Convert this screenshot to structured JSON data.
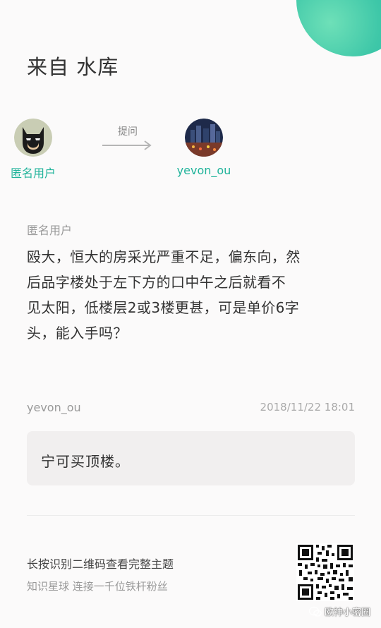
{
  "header": {
    "title": "来自 水库"
  },
  "participants": {
    "asker": {
      "name": "匿名用户",
      "avatar": "batman-mask-icon"
    },
    "action_label": "提问",
    "answerer": {
      "name": "yevon_ou",
      "avatar": "night-city-photo"
    }
  },
  "question": {
    "author": "匿名用户",
    "lines": [
      "殴大，恒大的房采光严重不足，偏东向，然",
      "后品字楼处于左下方的口中午之后就看不",
      "见太阳，低楼层2或3楼更甚，可是单价6字",
      "头，能入手吗？"
    ]
  },
  "answer": {
    "author": "yevon_ou",
    "time": "2018/11/22 18:01",
    "text": "宁可买顶楼。"
  },
  "footer": {
    "line1": "长按识别二维码查看完整主题",
    "line2": "知识星球 连接一千位铁杆粉丝"
  },
  "watermark": {
    "text": "欧神小密圈"
  },
  "colors": {
    "accent": "#1fb39a",
    "corner": "#3ec7a8"
  }
}
